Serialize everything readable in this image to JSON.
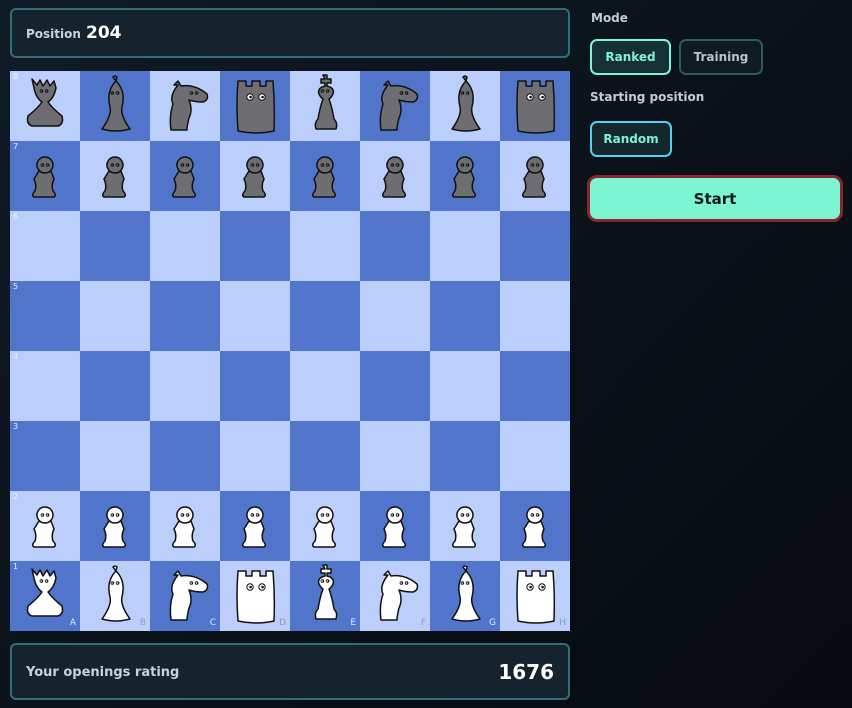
{
  "position": {
    "label": "Position",
    "value": "204"
  },
  "board": {
    "ranks": [
      "8",
      "7",
      "6",
      "5",
      "4",
      "3",
      "2",
      "1"
    ],
    "files": [
      "A",
      "B",
      "C",
      "D",
      "E",
      "F",
      "G",
      "H"
    ],
    "colors": {
      "light": "#bccffc",
      "dark": "#5275cc"
    },
    "pieces": [
      [
        "black-queen",
        "black-bishop",
        "black-knight",
        "black-rook",
        "black-king",
        "black-knight",
        "black-bishop",
        "black-rook"
      ],
      [
        "black-pawn",
        "black-pawn",
        "black-pawn",
        "black-pawn",
        "black-pawn",
        "black-pawn",
        "black-pawn",
        "black-pawn"
      ],
      [
        "",
        "",
        "",
        "",
        "",
        "",
        "",
        ""
      ],
      [
        "",
        "",
        "",
        "",
        "",
        "",
        "",
        ""
      ],
      [
        "",
        "",
        "",
        "",
        "",
        "",
        "",
        ""
      ],
      [
        "",
        "",
        "",
        "",
        "",
        "",
        "",
        ""
      ],
      [
        "white-pawn",
        "white-pawn",
        "white-pawn",
        "white-pawn",
        "white-pawn",
        "white-pawn",
        "white-pawn",
        "white-pawn"
      ],
      [
        "white-queen",
        "white-bishop",
        "white-knight",
        "white-rook",
        "white-king",
        "white-knight",
        "white-bishop",
        "white-rook"
      ]
    ]
  },
  "rating": {
    "label": "Your openings rating",
    "value": "1676"
  },
  "mode": {
    "label": "Mode",
    "options": [
      "Ranked",
      "Training"
    ],
    "selected": "Ranked"
  },
  "starting_position": {
    "label": "Starting position",
    "options": [
      "Random"
    ],
    "selected": "Random"
  },
  "start_button": {
    "label": "Start"
  },
  "accent_colors": {
    "mint": "#7df5d2",
    "panel_border": "#2e6f7a",
    "start_border": "#8a2530"
  }
}
